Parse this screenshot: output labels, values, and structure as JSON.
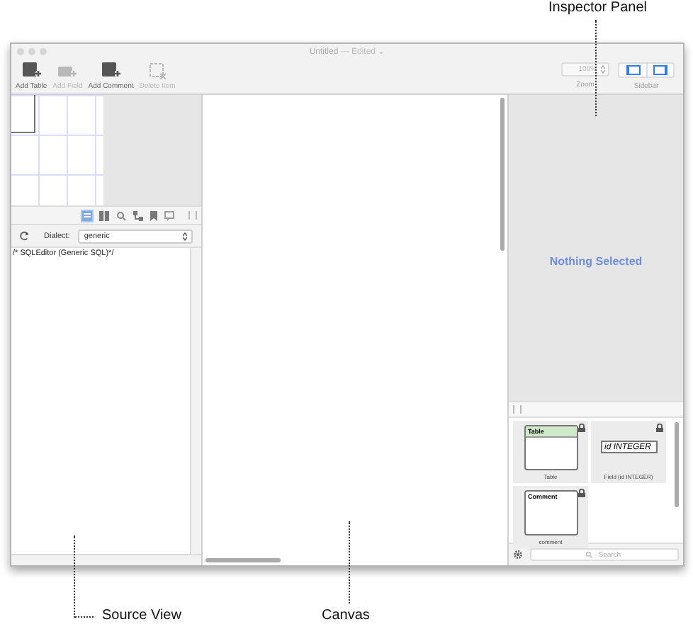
{
  "window": {
    "title": "Untitled",
    "title_suffix": "— Edited ⌄"
  },
  "toolbar": [
    {
      "kind": "add-table",
      "label": "Add Table",
      "disabled": false
    },
    {
      "kind": "add-field",
      "label": "Add Field",
      "disabled": true
    },
    {
      "kind": "add-comment",
      "label": "Add Comment",
      "disabled": false
    },
    {
      "kind": "delete",
      "label": "Delete Item",
      "disabled": true
    }
  ],
  "zoom": {
    "value": "100%",
    "label": "Zoom"
  },
  "sidebar": {
    "label": "Sidebar",
    "buttons": [
      {
        "kind": "left",
        "selected": true
      },
      {
        "kind": "right",
        "selected": true
      }
    ]
  },
  "source_pane": {
    "tabs": [
      {
        "kind": "list",
        "selected": true
      },
      {
        "kind": "book",
        "selected": false
      },
      {
        "kind": "search",
        "selected": false
      },
      {
        "kind": "tree",
        "selected": false
      },
      {
        "kind": "bookmark",
        "selected": false
      },
      {
        "kind": "comment",
        "selected": false
      }
    ],
    "dialect_label": "Dialect:",
    "dialect": "generic",
    "source_text": "/* SQLEditor (Generic SQL)*/"
  },
  "inspector": {
    "message": "Nothing Selected"
  },
  "library": {
    "items": [
      {
        "kind": "table",
        "header": "Table",
        "caption": "Table"
      },
      {
        "kind": "field",
        "header": "id INTEGER",
        "caption": "Field (id INTEGER)"
      },
      {
        "kind": "comment",
        "header": "Comment",
        "caption": "comment"
      }
    ],
    "search": {
      "placeholder": "Search"
    }
  },
  "annotations": [
    {
      "kind": "inspector",
      "text": "Inspector Panel"
    },
    {
      "kind": "source",
      "text": "Source View"
    },
    {
      "kind": "canvas",
      "text": "Canvas"
    }
  ]
}
